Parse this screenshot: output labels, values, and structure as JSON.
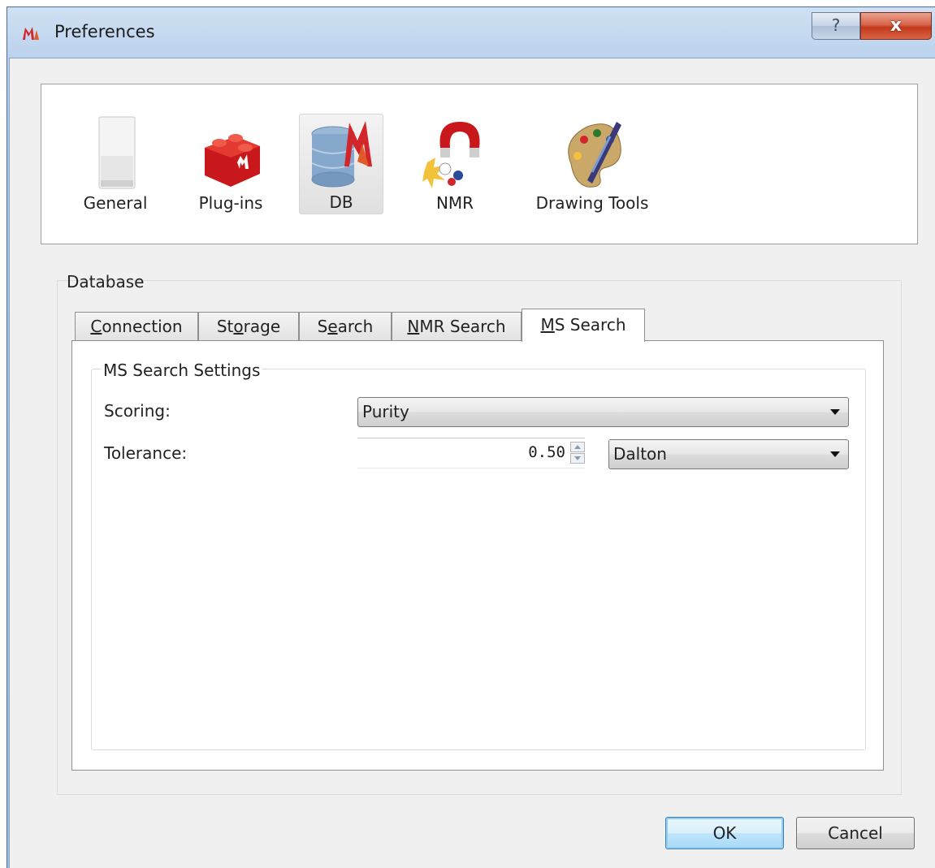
{
  "window": {
    "title": "Preferences",
    "help_glyph": "?",
    "close_glyph": "x",
    "app_icon": "marvin-m-logo-icon"
  },
  "categories": [
    {
      "label": "General",
      "icon": "general-panel-icon",
      "selected": false
    },
    {
      "label": "Plug-ins",
      "icon": "plugin-brick-icon",
      "selected": false
    },
    {
      "label": "DB",
      "icon": "database-icon",
      "selected": true
    },
    {
      "label": "NMR",
      "icon": "magnet-icon",
      "selected": false
    },
    {
      "label": "Drawing Tools",
      "icon": "palette-icon",
      "selected": false
    }
  ],
  "database": {
    "group_title": "Database",
    "tabs": [
      {
        "label": "Connection",
        "mnemonic": "C"
      },
      {
        "label": "Storage",
        "mnemonic": "o"
      },
      {
        "label": "Search",
        "mnemonic": "e"
      },
      {
        "label": "NMR Search",
        "mnemonic": "N"
      },
      {
        "label": "MS Search",
        "mnemonic": "M",
        "active": true
      }
    ],
    "ms_settings": {
      "group_title": "MS Search Settings",
      "scoring_label": "Scoring:",
      "scoring_value": "Purity",
      "tolerance_label": "Tolerance:",
      "tolerance_value": "0.50",
      "tolerance_unit": "Dalton"
    }
  },
  "buttons": {
    "ok": "OK",
    "cancel": "Cancel"
  }
}
